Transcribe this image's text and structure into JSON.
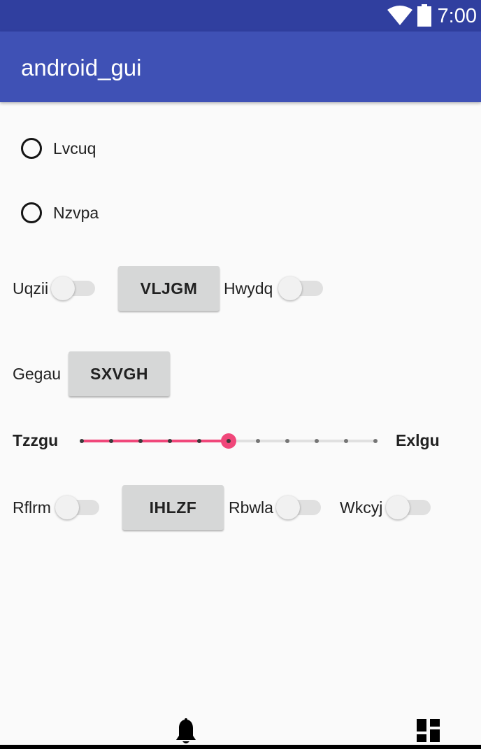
{
  "status_bar": {
    "time": "7:00",
    "icons": [
      "wifi-icon",
      "battery-icon"
    ],
    "color": "#303f9f"
  },
  "app_bar": {
    "title": "android_gui",
    "color": "#3f51b5"
  },
  "radios": [
    {
      "label": "Lvcuq",
      "checked": false
    },
    {
      "label": "Nzvpa",
      "checked": false
    }
  ],
  "row1": {
    "switch1_label": "Uqzii",
    "button_label": "VLJGM",
    "switch2_label": "Hwydq"
  },
  "row2": {
    "label": "Gegau",
    "button_label": "SXVGH"
  },
  "slider": {
    "start_label": "Tzzgu",
    "end_label": "Exlgu",
    "value": 5,
    "max": 10,
    "accent": "#f0477a"
  },
  "row3": {
    "switch1_label": "Rflrm",
    "button_label": "IHLZF",
    "switch2_label": "Rbwla",
    "switch3_label": "Wkcyj"
  },
  "bottom_bar": {
    "icons": [
      "bell-icon",
      "dashboard-icon"
    ]
  }
}
